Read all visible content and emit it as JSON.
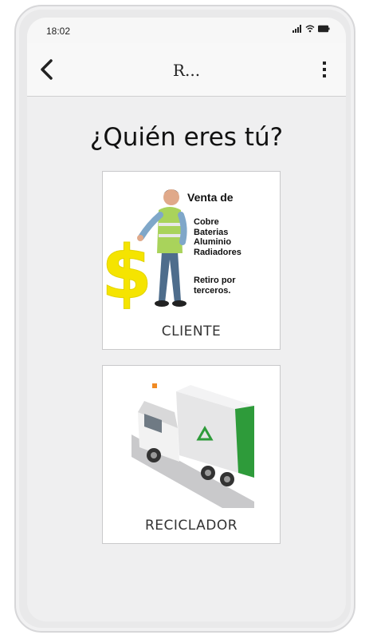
{
  "status_bar": {
    "time": "18:02"
  },
  "app_bar": {
    "title": "R...",
    "icons": {
      "back": "chevron-left-icon",
      "menu": "more-vertical-icon"
    }
  },
  "main": {
    "title": "¿Quién eres tú?",
    "cards": [
      {
        "label": "CLIENTE",
        "art": {
          "heading": "Venta de",
          "items": [
            "Cobre",
            "Baterias",
            "Aluminio",
            "Radiadores"
          ],
          "note": [
            "Retiro por",
            "terceros."
          ]
        }
      },
      {
        "label": "RECICLADOR"
      }
    ]
  },
  "colors": {
    "dollar_yellow": "#f5e400",
    "vest_green": "#a9d35b",
    "truck_green": "#2e9b3a"
  }
}
